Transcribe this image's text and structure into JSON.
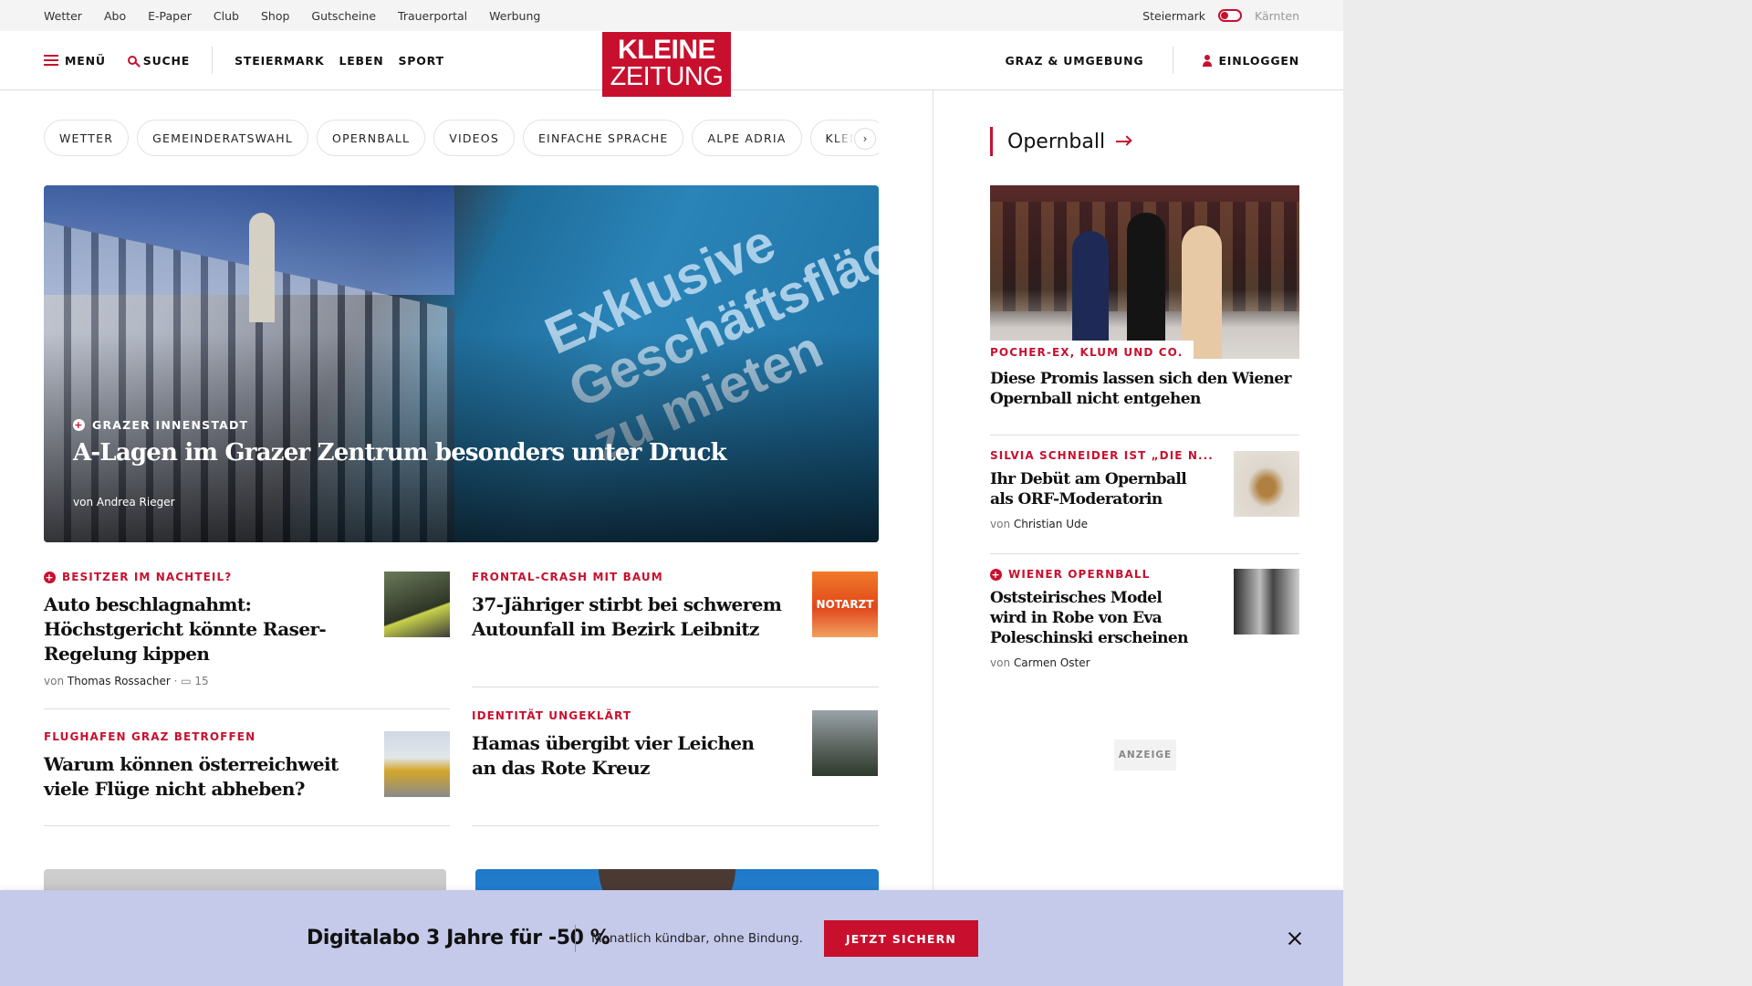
{
  "utility": {
    "links": [
      "Wetter",
      "Abo",
      "E-Paper",
      "Club",
      "Shop",
      "Gutscheine",
      "Trauerportal",
      "Werbung"
    ],
    "region_active": "Steiermark",
    "region_inactive": "Kärnten"
  },
  "header": {
    "menu": "MENÜ",
    "search": "SUCHE",
    "nav": [
      "STEIERMARK",
      "LEBEN",
      "SPORT"
    ],
    "logo_line1": "KLEINE",
    "logo_line2": "ZEITUNG",
    "local": "GRAZ & UMGEBUNG",
    "login": "EINLOGGEN"
  },
  "chips": [
    "WETTER",
    "GEMEINDERATSWAHL",
    "OPERNBALL",
    "VIDEOS",
    "EINFACHE SPRACHE",
    "ALPE ADRIA",
    "KLEINE"
  ],
  "hero": {
    "kicker": "GRAZER INNENSTADT",
    "title": "A-Lagen im Grazer Zentrum besonders unter Druck",
    "byline": "von Andrea Rieger",
    "image_text_line1": "Exklusive",
    "image_text_line2": "Geschäftsfläche",
    "image_text_line3": "zu mieten"
  },
  "teasers": {
    "t1": {
      "kicker": "BESITZER IM NACHTEIL?",
      "title": "Auto beschlagnahmt: Höchstgericht könnte Raser-Regelung kippen",
      "author_prefix": "von",
      "author": "Thomas Rossacher",
      "comments": "15"
    },
    "t2": {
      "kicker": "FRONTAL-CRASH MIT BAUM",
      "title": "37-Jähriger stirbt bei schwerem Autounfall im Bezirk Leibnitz",
      "thumb_text": "NOTARZT"
    },
    "t3": {
      "kicker": "FLUGHAFEN GRAZ BETROFFEN",
      "title": "Warum können österreichweit viele Flüge nicht abheben?"
    },
    "t4": {
      "kicker": "IDENTITÄT UNGEKLÄRT",
      "title": "Hamas übergibt vier Leichen an das Rote Kreuz"
    }
  },
  "sidebar": {
    "title": "Opernball",
    "lead": {
      "kicker": "POCHER-EX, KLUM UND CO.",
      "title": "Diese Promis lassen sich den Wiener Opernball nicht entgehen"
    },
    "s1": {
      "kicker": "SILVIA SCHNEIDER IST „DIE N...",
      "title": "Ihr Debüt am Opernball als ORF-Moderatorin",
      "author_prefix": "von",
      "author": "Christian Ude"
    },
    "s2": {
      "kicker": "WIENER OPERNBALL",
      "title": "Oststeirisches Model wird in Robe von Eva Poleschinski erscheinen",
      "author_prefix": "von",
      "author": "Carmen Oster"
    },
    "ad_label": "ANZEIGE"
  },
  "promo": {
    "title": "Digitalabo 3 Jahre für -50 %",
    "subtitle": "Monatlich kündbar, ohne Bindung.",
    "cta": "JETZT SICHERN"
  },
  "colors": {
    "brand_red": "#c8102e",
    "promo_bg": "#c5c9ea"
  }
}
